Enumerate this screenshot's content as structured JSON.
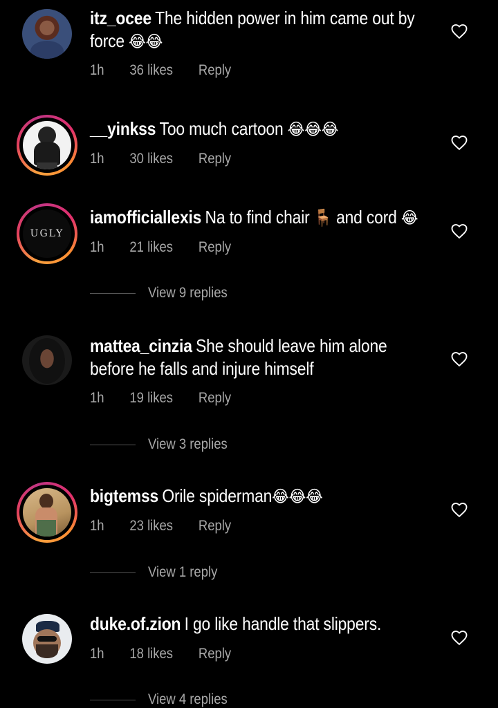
{
  "comments": [
    {
      "username": "itz_ocee",
      "text": "The hidden power in him came out by force",
      "emoji": "😂😂",
      "time": "1h",
      "likes": "36 likes",
      "reply": "Reply",
      "ring": false,
      "view_replies": null
    },
    {
      "username": "__yinkss",
      "text": "Too much cartoon",
      "emoji": "😂😂😂",
      "time": "1h",
      "likes": "30 likes",
      "reply": "Reply",
      "ring": true,
      "view_replies": null
    },
    {
      "username": "iamofficiallexis",
      "text": "Na to find chair",
      "emoji": "🪑",
      "text2": "and cord",
      "emoji2": "😂",
      "time": "1h",
      "likes": "21 likes",
      "reply": "Reply",
      "ring": true,
      "avatar_text": "UGLY",
      "view_replies": "View 9 replies"
    },
    {
      "username": "mattea_cinzia",
      "text": "She should leave him alone before he falls and injure himself",
      "time": "1h",
      "likes": "19 likes",
      "reply": "Reply",
      "ring": false,
      "view_replies": "View 3 replies"
    },
    {
      "username": "bigtemss",
      "text": "Orile spiderman",
      "emoji": "😂😂😂",
      "time": "1h",
      "likes": "23 likes",
      "reply": "Reply",
      "ring": true,
      "view_replies": "View 1 reply"
    },
    {
      "username": "duke.of.zion",
      "text": "I go like handle that slippers.",
      "time": "1h",
      "likes": "18 likes",
      "reply": "Reply",
      "ring": false,
      "view_replies": "View 4 replies"
    }
  ],
  "colors": {
    "background": "#000000",
    "text": "#ffffff",
    "secondary_text": "#a8a8a8",
    "story_ring_start": "#f9a03f",
    "story_ring_end": "#c13584"
  },
  "icons": {
    "like": "heart-outline-icon"
  }
}
